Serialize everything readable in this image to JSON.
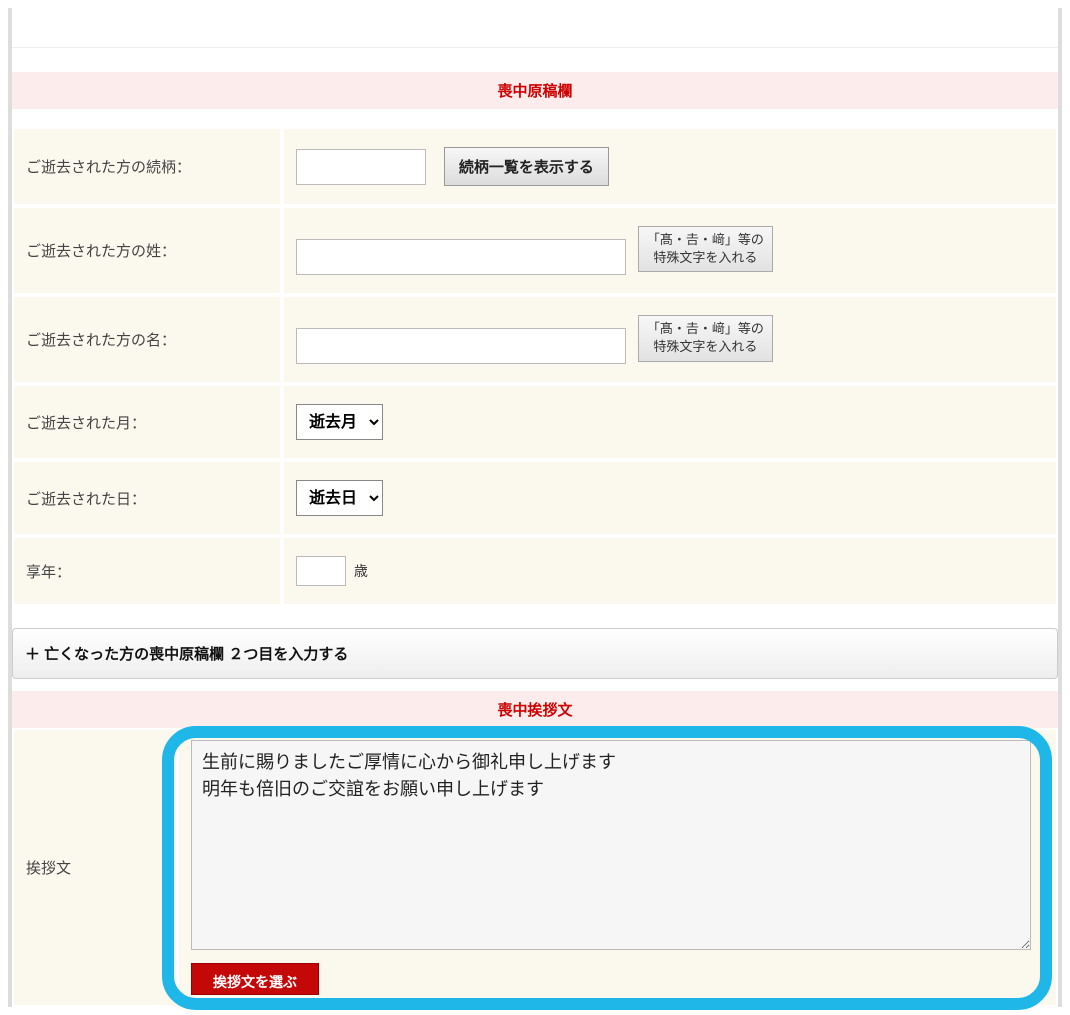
{
  "section1": {
    "title": "喪中原稿欄",
    "rows": {
      "relation": {
        "label": "ご逝去された方の続柄：",
        "btn": "続柄一覧を表示する"
      },
      "surname": {
        "label": "ご逝去された方の姓：",
        "special_btn_l1": "「髙・𠮷・﨑」等の",
        "special_btn_l2": "特殊文字を入れる"
      },
      "givenname": {
        "label": "ご逝去された方の名：",
        "special_btn_l1": "「髙・𠮷・﨑」等の",
        "special_btn_l2": "特殊文字を入れる"
      },
      "month": {
        "label": "ご逝去された月：",
        "selected": "逝去月"
      },
      "day": {
        "label": "ご逝去された日：",
        "selected": "逝去日"
      },
      "age": {
        "label": "享年：",
        "unit": "歳"
      }
    }
  },
  "expand": {
    "label": "＋ 亡くなった方の喪中原稿欄 ２つ目を入力する"
  },
  "section2": {
    "title": "喪中挨拶文",
    "row_label": "挨拶文",
    "textarea_value": "生前に賜りましたご厚情に心から御礼申し上げます\n明年も倍旧のご交誼をお願い申し上げます",
    "red_btn": "挨拶文を選ぶ"
  }
}
